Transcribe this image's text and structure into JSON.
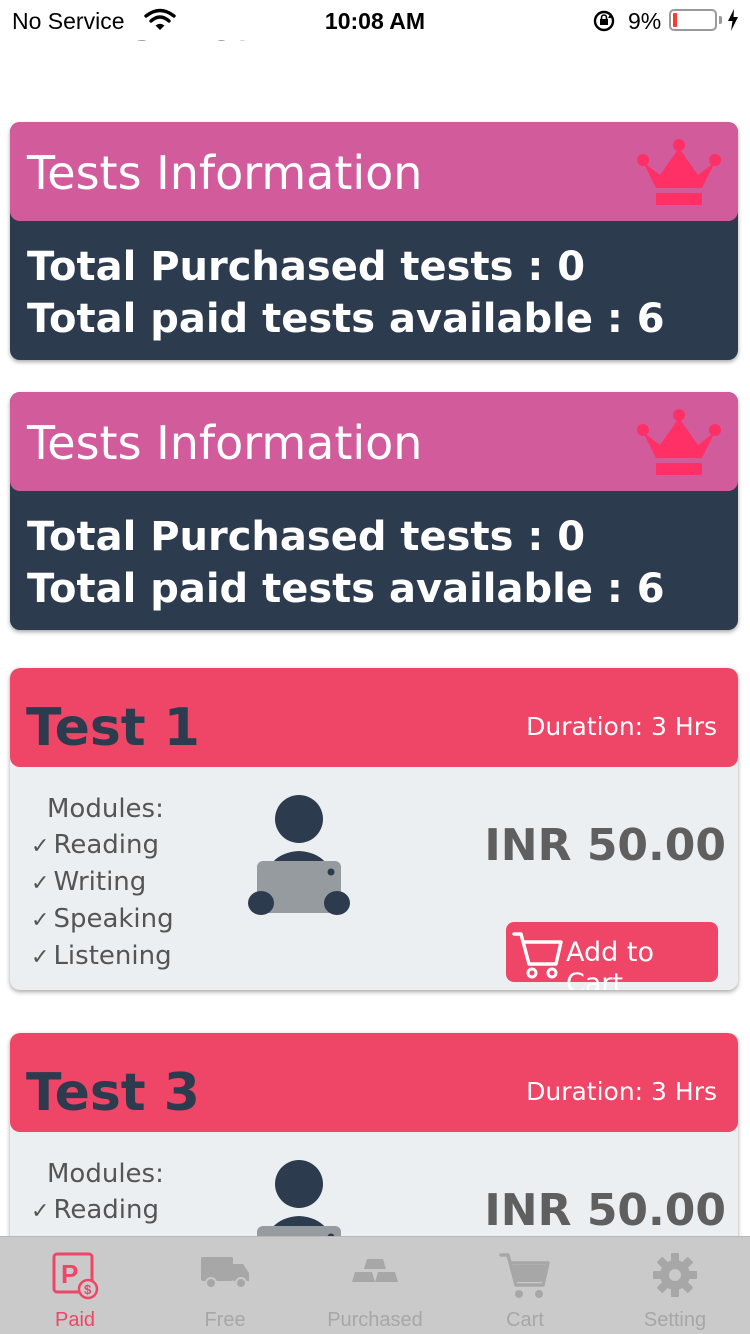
{
  "status_bar": {
    "carrier": "No Service",
    "time": "10:08 AM",
    "battery_percent": "9%",
    "battery_level": 0.09,
    "battery_color": "#ff3b30"
  },
  "page": {
    "heading_partial": "Anchal"
  },
  "info_cards": [
    {
      "title": "Tests Information",
      "icon": "crown-icon",
      "purchased": "Total Purchased tests : 0",
      "available": "Total paid tests available : 6"
    },
    {
      "title": "Tests Information",
      "icon": "crown-icon",
      "purchased": "Total Purchased tests : 0",
      "available": "Total paid tests available : 6"
    }
  ],
  "tests": [
    {
      "name": "Test 1",
      "duration": "Duration: 3 Hrs",
      "modules_label": "Modules:",
      "modules": [
        "Reading",
        "Writing",
        "Speaking",
        "Listening"
      ],
      "price": "INR 50.00",
      "add_to_cart": "Add to Cart"
    },
    {
      "name": "Test 3",
      "duration": "Duration: 3 Hrs",
      "modules_label": "Modules:",
      "modules": [
        "Reading"
      ],
      "price": "INR 50.00"
    }
  ],
  "check_mark": "✓",
  "tab_bar": {
    "tabs": [
      {
        "label": "Paid",
        "icon": "paid-icon",
        "active": true
      },
      {
        "label": "Free",
        "icon": "free-truck-icon",
        "active": false
      },
      {
        "label": "Purchased",
        "icon": "gold-bars-icon",
        "active": false
      },
      {
        "label": "Cart",
        "icon": "cart-icon",
        "active": false
      },
      {
        "label": "Setting",
        "icon": "gear-icon",
        "active": false
      }
    ]
  },
  "colors": {
    "info_header": "#d25b9c",
    "card_dark": "#2d3b4f",
    "accent": "#ef4566",
    "crown": "#ff3066",
    "tab_inactive": "#a7a7a7"
  }
}
